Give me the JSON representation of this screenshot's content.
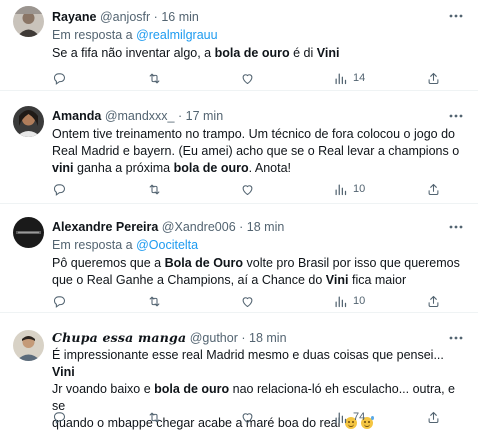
{
  "tweets": [
    {
      "name": "Rayane",
      "handle": "@anjosfr",
      "dot": "·",
      "time": "16 min",
      "reply_prefix": "Em resposta a",
      "reply_to": "@realmilgrauu",
      "body": [
        {
          "t": "Se a fifa não inventar algo, a ",
          "b": false
        },
        {
          "t": "bola de ouro",
          "b": true
        },
        {
          "t": " é di ",
          "b": false
        },
        {
          "t": "Vini",
          "b": true
        }
      ],
      "views": "14",
      "avatar_icon": "profile-photo-woman"
    },
    {
      "name": "Amanda",
      "handle": "@mandxxx_",
      "dot": "·",
      "time": "17 min",
      "body_lines": [
        [
          {
            "t": "Ontem tive treinamento no trampo. Um técnico de fora colocou o jogo do",
            "b": false
          }
        ],
        [
          {
            "t": "Real Madrid e bayern. (Eu amei)  acho que se o Real levar a champions o",
            "b": false
          }
        ],
        [
          {
            "t": "vini",
            "b": true
          },
          {
            "t": " ganha a próxima ",
            "b": false
          },
          {
            "t": "bola de ouro",
            "b": true
          },
          {
            "t": ". Anota!",
            "b": false
          }
        ]
      ],
      "views": "10",
      "avatar_icon": "profile-photo-woman-dark"
    },
    {
      "name": "Alexandre Pereira",
      "handle": "@Xandre006",
      "dot": "·",
      "time": "18 min",
      "reply_prefix": "Em resposta a",
      "reply_to": "@Oocitelta",
      "body_lines": [
        [
          {
            "t": "Pô queremos que a ",
            "b": false
          },
          {
            "t": "Bola de Ouro",
            "b": true
          },
          {
            "t": " volte pro Brasil por isso que queremos",
            "b": false
          }
        ],
        [
          {
            "t": "que o Real Ganhe a Champions, aí a Chance do ",
            "b": false
          },
          {
            "t": "Vini",
            "b": true
          },
          {
            "t": " fica maior",
            "b": false
          }
        ]
      ],
      "views": "10",
      "avatar_icon": "profile-logo-dark"
    },
    {
      "name": "Chupa essa manga",
      "handle": "@guthor",
      "dot": "·",
      "time": "18 min",
      "body_lines": [
        [
          {
            "t": "É impressionante esse real Madrid mesmo e duas coisas que pensei... ",
            "b": false
          },
          {
            "t": "Vini",
            "b": true
          }
        ],
        [
          {
            "t": "Jr voando baixo e ",
            "b": false
          },
          {
            "t": "bola de ouro",
            "b": true
          },
          {
            "t": " nao relaciona-ló eh esculacho... outra, e se",
            "b": false
          }
        ],
        [
          {
            "t": "quando o mbappe chegar acabe a maré boa do real ",
            "b": false
          }
        ]
      ],
      "emojis": [
        "relieved-face-emoji",
        "grinning-sweat-emoji"
      ],
      "views": "74",
      "avatar_icon": "profile-photo-man"
    }
  ],
  "icons": {
    "reply": "reply-icon",
    "retweet": "retweet-icon",
    "like": "like-icon",
    "views": "views-icon",
    "share": "share-icon",
    "more": "more-icon"
  },
  "colors": {
    "link": "#1d9bf0",
    "muted": "#536471",
    "text": "#0f1419",
    "divider": "#eff3f4"
  }
}
